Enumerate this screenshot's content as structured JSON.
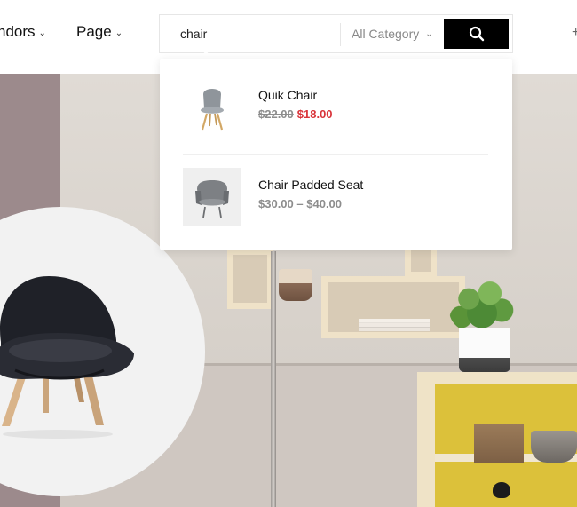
{
  "nav": {
    "items": [
      {
        "label": "ndors"
      },
      {
        "label": "Page"
      }
    ]
  },
  "search": {
    "query": "chair",
    "category": "All Category"
  },
  "suggestions": [
    {
      "name": "Quik Chair",
      "old_price": "$22.00",
      "price": "$18.00"
    },
    {
      "name": "Chair Padded Seat",
      "price_min": "$30.00",
      "price_separator": "–",
      "price_max": "$40.00"
    }
  ],
  "colors": {
    "sale_price": "#d9343a",
    "search_button": "#000000",
    "accent_mauve": "#9c8a8c"
  },
  "icons": [
    "chevron-down-icon",
    "search-icon"
  ]
}
